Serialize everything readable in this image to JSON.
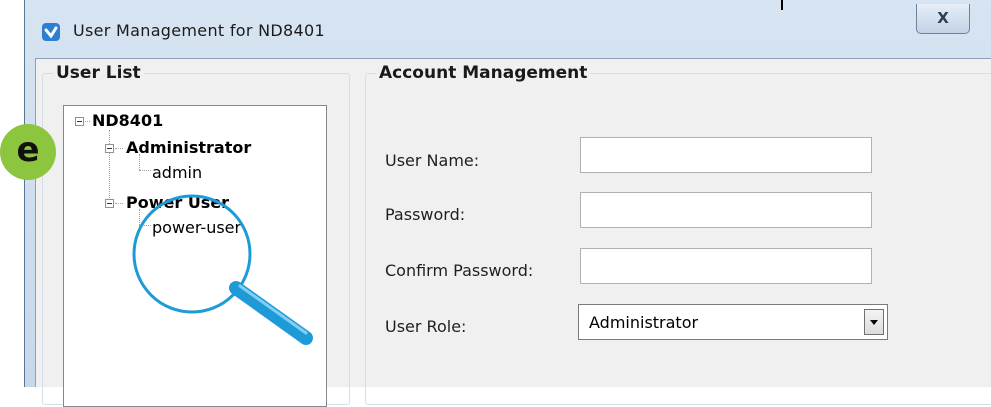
{
  "window": {
    "title": "User Management for ND8401",
    "close_label": "X",
    "app_icon": "dialog-app-icon"
  },
  "user_list": {
    "group_title": "User List",
    "tree": {
      "root": "ND8401",
      "groups": [
        {
          "label": "Administrator",
          "children": [
            "admin"
          ]
        },
        {
          "label": "Power User",
          "children": [
            "power-user"
          ]
        }
      ]
    }
  },
  "account": {
    "group_title": "Account Management",
    "fields": {
      "user_name": {
        "label": "User Name:",
        "value": ""
      },
      "password": {
        "label": "Password:",
        "value": ""
      },
      "confirm_password": {
        "label": "Confirm Password:",
        "value": ""
      },
      "user_role": {
        "label": "User Role:",
        "selected": "Administrator"
      }
    }
  },
  "annotation": {
    "badge_letter": "e",
    "badge_color": "#8cc63f",
    "magnifier_color": "#1e9bd7",
    "icons": [
      "chevron-down-icon",
      "magnifier-icon"
    ]
  }
}
